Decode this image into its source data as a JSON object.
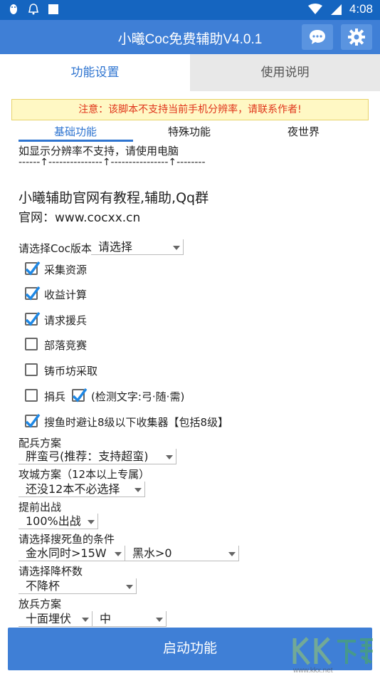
{
  "status": {
    "time": "4:08"
  },
  "app": {
    "title": "小曦Coc免费辅助V4.0.1"
  },
  "tabs": [
    {
      "label": "功能设置"
    },
    {
      "label": "使用说明"
    }
  ],
  "notice": "注意：该脚本不支持当前手机分辨率，请联系作者!",
  "subtabs": [
    {
      "label": "基础功能"
    },
    {
      "label": "特殊功能"
    },
    {
      "label": "夜世界"
    }
  ],
  "note": "如显示分辨率不支持，请使用电脑",
  "arrow_line": "------↑---------------↑----------------↑--------",
  "info": {
    "headline": "小曦辅助官网有教程,辅助,Qq群",
    "url": "官网：www.cocxx.cn"
  },
  "version_select": {
    "label": "请选择Coc版本",
    "value": "请选择"
  },
  "checkboxes": [
    {
      "label": "采集资源",
      "checked": true
    },
    {
      "label": "收益计算",
      "checked": true
    },
    {
      "label": "请求援兵",
      "checked": true
    },
    {
      "label": "部落竞赛",
      "checked": false
    },
    {
      "label": "铸币坊采取",
      "checked": false
    },
    {
      "label": "捐兵",
      "checked": false
    },
    {
      "label": "(检测文字:弓·随·需)",
      "checked": true
    },
    {
      "label": "搜鱼时避让8级以下收集器【包括8级】",
      "checked": true
    }
  ],
  "troop_plan": {
    "label": "配兵方案",
    "value": "胖蛮弓(推荐：支持超蛮)"
  },
  "siege_plan": {
    "label": "攻城方案（12本以上专属）",
    "value": "还没12本不必选择"
  },
  "early_exit": {
    "label": "提前出战",
    "value": "100%出战"
  },
  "dead_base": {
    "label": "请选择搜死鱼的条件",
    "value1": "金水同时>15W",
    "value2": "黑水>0"
  },
  "trophy": {
    "label": "请选择降杯数",
    "value": "不降杯"
  },
  "deploy": {
    "label": "放兵方案",
    "value1": "十面埋伏",
    "value2": "中"
  },
  "start_button": "启动功能",
  "watermark": {
    "text": "www.kkx.net"
  },
  "colors": {
    "primary": "#3f7fd6",
    "status_bar": "#1565c0",
    "accent": "#2e74d0",
    "warning": "#e0351b",
    "check": "#1e88e5"
  }
}
